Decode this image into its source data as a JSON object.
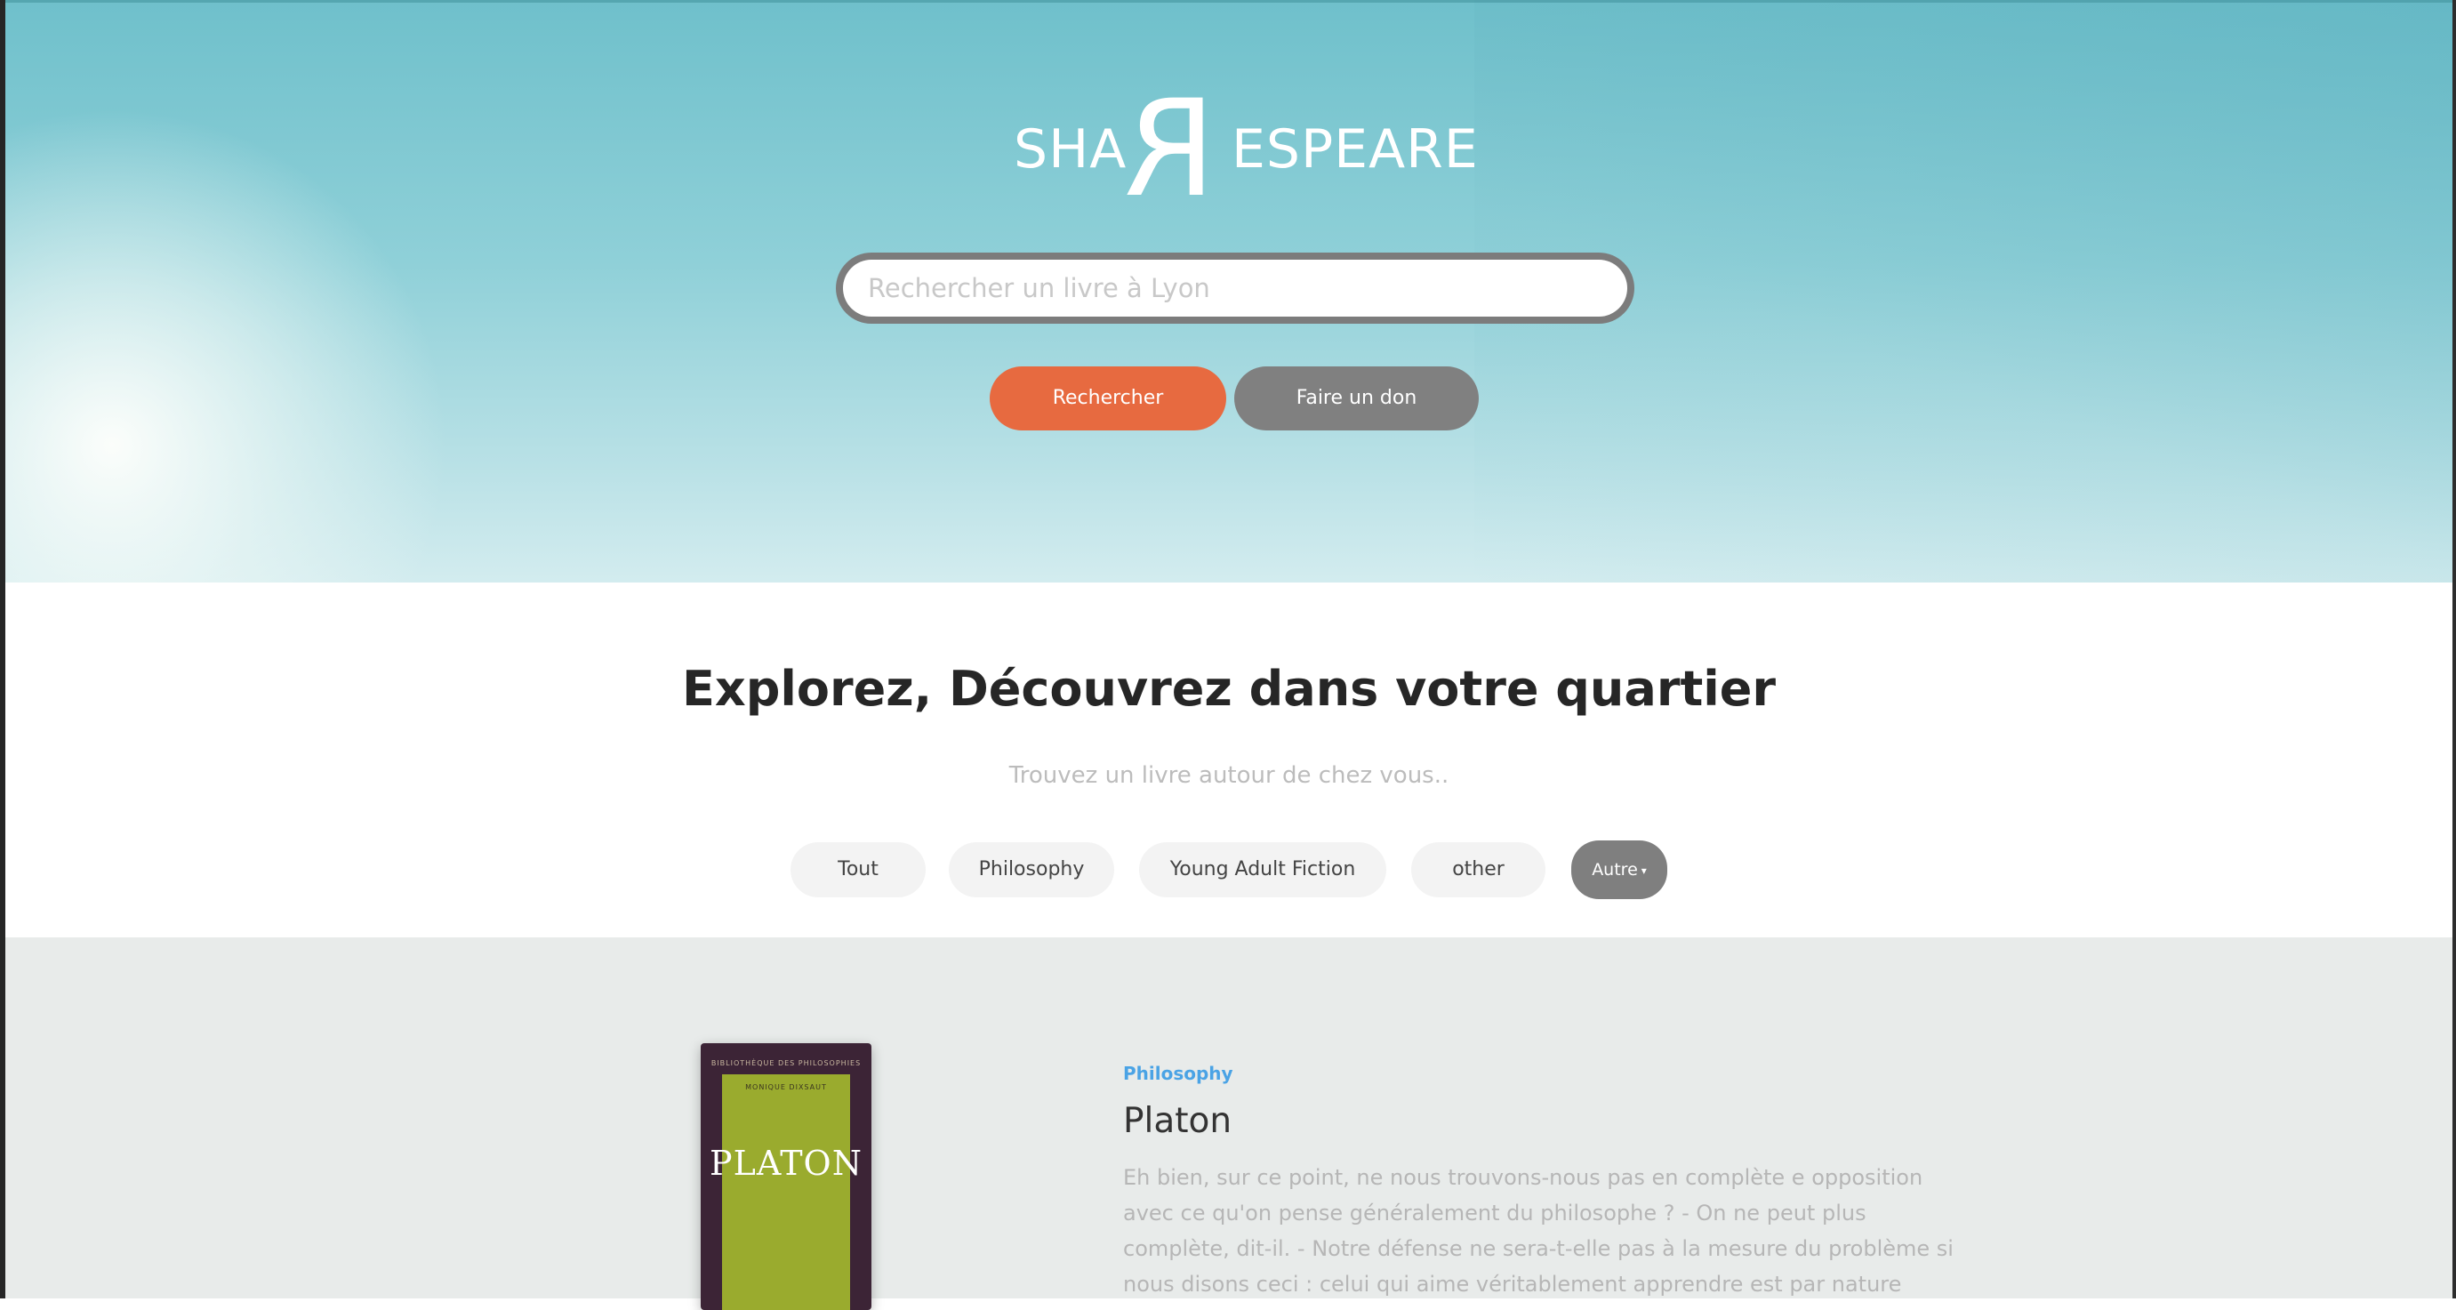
{
  "header": {
    "logo": {
      "left": "SHA",
      "mirrored_letter": "R",
      "right": "ESPEARE"
    },
    "search": {
      "placeholder": "Rechercher un livre à Lyon",
      "value": ""
    },
    "buttons": {
      "search": "Rechercher",
      "donate": "Faire un don"
    }
  },
  "explore": {
    "title": "Explorez, Découvrez dans votre quartier",
    "subtitle": "Trouvez un livre autour de chez vous..",
    "filters": [
      "Tout",
      "Philosophy",
      "Young Adult Fiction",
      "other"
    ],
    "dropdown": {
      "label": "Autre"
    }
  },
  "book": {
    "category": "Philosophy",
    "title": "Platon",
    "description": "Eh bien, sur ce point, ne nous trouvons-nous pas en complète e opposition avec ce qu'on pense généralement du philosophe ? - On ne peut plus complète, dit-il. - Notre défense ne sera-t-elle pas à la mesure du problème si nous disons ceci : celui qui aime véritablement apprendre est par nature",
    "cover": {
      "series": "BIBLIOTHÈQUE DES PHILOSOPHIES",
      "author": "MONIQUE DIXSAUT",
      "title": "PLATON"
    }
  },
  "colors": {
    "hero_top": "#6fc0cb",
    "accent_orange": "#e76a40",
    "button_gray": "#808080",
    "category_blue": "#4aa3e5",
    "listing_bg": "#e8ebea"
  }
}
